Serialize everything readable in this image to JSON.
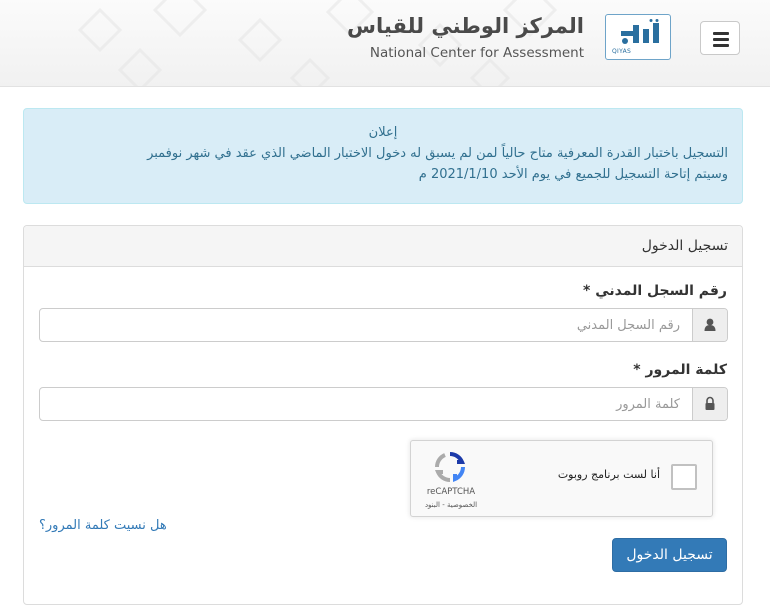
{
  "header": {
    "org_name_ar": "المركز الوطني للقياس",
    "org_name_en": "National Center for Assessment",
    "logo_caption": "QIYAS",
    "menu_icon": "hamburger-menu-icon"
  },
  "announcement": {
    "title": "إعلان",
    "line1": "التسجيل باختبار القدرة المعرفية متاح حالياً لمن لم يسبق له دخول الاختبار الماضي الذي عقد في شهر نوفمبر",
    "line2": "وسيتم إتاحة التسجيل للجميع في يوم الأحد 2021/1/10 م"
  },
  "login": {
    "heading": "تسجيل الدخول",
    "national_id_label": "رقم السجل المدني *",
    "national_id_placeholder": "رقم السجل المدني",
    "national_id_icon": "user-icon",
    "password_label": "كلمة المرور *",
    "password_placeholder": "كلمة المرور",
    "password_icon": "lock-icon",
    "forgot_password": "هل نسيت كلمة المرور؟",
    "submit": "تسجيل الدخول"
  },
  "captcha": {
    "label": "أنا لست برنامج روبوت",
    "brand": "reCAPTCHA",
    "links": "الخصوصية - البنود"
  },
  "colors": {
    "alert_bg": "#d9edf7",
    "alert_text": "#31708f",
    "primary": "#337ab7",
    "link": "#337ab7"
  }
}
